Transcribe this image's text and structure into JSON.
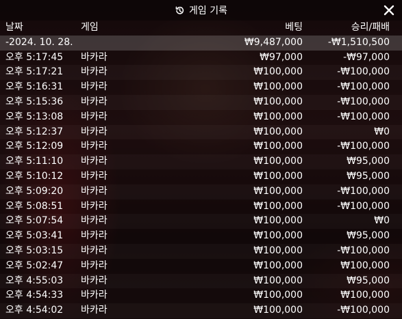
{
  "header": {
    "title": "게임 기록"
  },
  "columns": {
    "date": "날짜",
    "game": "게임",
    "bet": "베팅",
    "winloss": "승리/패배"
  },
  "summary": {
    "date": "-2024. 10. 28.",
    "bet": "₩9,487,000",
    "winloss": "-₩1,510,500"
  },
  "rows": [
    {
      "time": "오후 5:17:45",
      "game": "바카라",
      "bet": "₩97,000",
      "winloss": "-₩97,000"
    },
    {
      "time": "오후 5:17:21",
      "game": "바카라",
      "bet": "₩100,000",
      "winloss": "-₩100,000"
    },
    {
      "time": "오후 5:16:31",
      "game": "바카라",
      "bet": "₩100,000",
      "winloss": "-₩100,000"
    },
    {
      "time": "오후 5:15:36",
      "game": "바카라",
      "bet": "₩100,000",
      "winloss": "-₩100,000"
    },
    {
      "time": "오후 5:13:08",
      "game": "바카라",
      "bet": "₩100,000",
      "winloss": "-₩100,000"
    },
    {
      "time": "오후 5:12:37",
      "game": "바카라",
      "bet": "₩100,000",
      "winloss": "₩0"
    },
    {
      "time": "오후 5:12:09",
      "game": "바카라",
      "bet": "₩100,000",
      "winloss": "-₩100,000"
    },
    {
      "time": "오후 5:11:10",
      "game": "바카라",
      "bet": "₩100,000",
      "winloss": "₩95,000"
    },
    {
      "time": "오후 5:10:12",
      "game": "바카라",
      "bet": "₩100,000",
      "winloss": "₩95,000"
    },
    {
      "time": "오후 5:09:20",
      "game": "바카라",
      "bet": "₩100,000",
      "winloss": "-₩100,000"
    },
    {
      "time": "오후 5:08:51",
      "game": "바카라",
      "bet": "₩100,000",
      "winloss": "-₩100,000"
    },
    {
      "time": "오후 5:07:54",
      "game": "바카라",
      "bet": "₩100,000",
      "winloss": "₩0"
    },
    {
      "time": "오후 5:03:41",
      "game": "바카라",
      "bet": "₩100,000",
      "winloss": "₩95,000"
    },
    {
      "time": "오후 5:03:15",
      "game": "바카라",
      "bet": "₩100,000",
      "winloss": "-₩100,000"
    },
    {
      "time": "오후 5:02:47",
      "game": "바카라",
      "bet": "₩100,000",
      "winloss": "₩100,000"
    },
    {
      "time": "오후 4:55:03",
      "game": "바카라",
      "bet": "₩100,000",
      "winloss": "₩95,000"
    },
    {
      "time": "오후 4:54:33",
      "game": "바카라",
      "bet": "₩100,000",
      "winloss": "₩100,000"
    },
    {
      "time": "오후 4:54:02",
      "game": "바카라",
      "bet": "₩100,000",
      "winloss": "-₩100,000"
    }
  ]
}
